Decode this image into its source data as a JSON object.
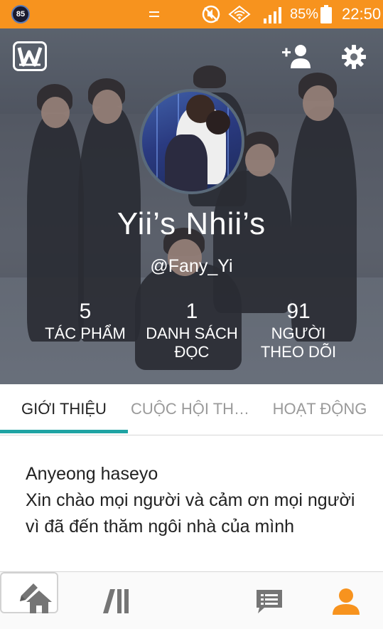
{
  "status_bar": {
    "badge": "85",
    "battery_pct": "85%",
    "time": "22:50",
    "icons": [
      "notification-badge-icon",
      "minimize-icon",
      "mute-icon",
      "wifi-icon",
      "signal-icon",
      "battery-icon"
    ]
  },
  "header": {
    "logo_icon": "wattpad-logo-icon",
    "actions": [
      "add-user-icon",
      "gear-icon"
    ]
  },
  "profile": {
    "display_name": "Yii’s Nhii’s",
    "username": "@Fany_Yi",
    "stats": [
      {
        "value": "5",
        "label": "TÁC PHẨM"
      },
      {
        "value": "1",
        "label": "DANH SÁCH ĐỌC"
      },
      {
        "value": "91",
        "label": "NGƯỜI THEO DÕI"
      }
    ]
  },
  "tabs": [
    {
      "label": "GIỚI THIỆU",
      "active": true
    },
    {
      "label": "CUỘC HỘI THOẠI",
      "active": false
    },
    {
      "label": "HOẠT ĐỘNG",
      "active": false
    }
  ],
  "about": {
    "text": "Anyeong haseyo\nXin chào mọi người và cảm ơn mọi người vì đã đến thăm ngôi nhà của mình"
  },
  "bottom_nav": {
    "items": [
      "home-icon",
      "library-icon",
      "pencil-icon",
      "messages-icon",
      "profile-icon"
    ],
    "active": "profile-icon",
    "accent": "#f7931e",
    "inactive": "#757575"
  },
  "colors": {
    "status_bar": "#f7931e",
    "tab_underline": "#1fa3a3"
  }
}
